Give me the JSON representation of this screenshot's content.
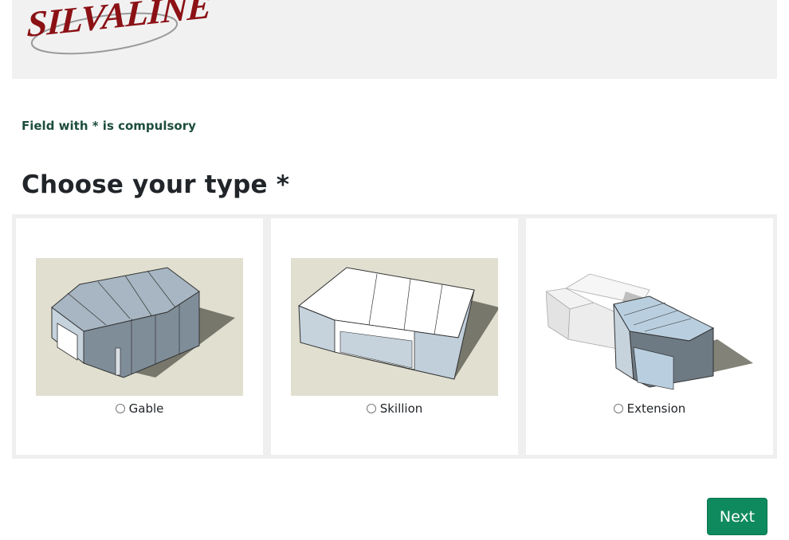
{
  "header": {
    "logo_text": "SILVALINE"
  },
  "form": {
    "compulsory_note": "Field with * is compulsory",
    "title": "Choose your type *",
    "options": [
      {
        "label": "Gable",
        "selected": false,
        "image": "gable-shed-image"
      },
      {
        "label": "Skillion",
        "selected": false,
        "image": "skillion-shed-image"
      },
      {
        "label": "Extension",
        "selected": false,
        "image": "extension-shed-image"
      }
    ],
    "next_label": "Next"
  },
  "colors": {
    "header_bg": "#f1f1f1",
    "logo_red": "#8b1115",
    "note_green": "#1d4d3c",
    "button_green": "#0f8a5f",
    "image_bg": "#e0dfd0"
  }
}
